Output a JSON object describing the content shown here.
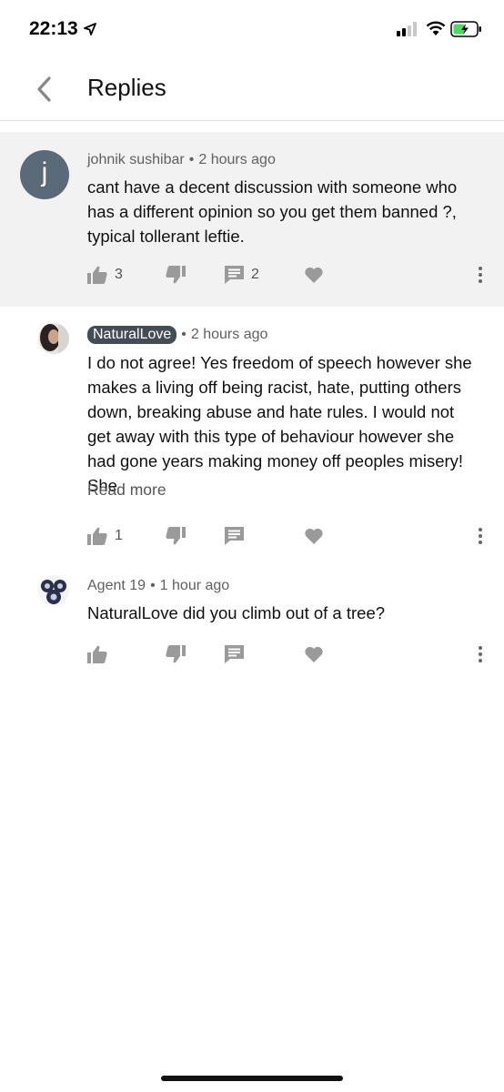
{
  "status_bar": {
    "time": "22:13"
  },
  "header": {
    "title": "Replies"
  },
  "comments": [
    {
      "author": "johnik sushibar",
      "avatar_letter": "j",
      "time": "2 hours ago",
      "text": "cant have a decent discussion with someone who has a different opinion so you get them banned ?, typical tollerant leftie.",
      "likes": "3",
      "replies": "2",
      "highlighted": true
    },
    {
      "author": "NaturalLove",
      "time": "2 hours ago",
      "text": "I do not agree! Yes freedom of speech however she makes a living off being racist, hate, putting others down, breaking abuse and hate rules. I would not get away with this type of behaviour however she had gone years making money off peoples misery! She",
      "read_more": "Read more",
      "likes": "1",
      "author_is_op": true
    },
    {
      "author": "Agent 19",
      "time": "1 hour ago",
      "text": "NaturalLove did you climb out of a tree?"
    }
  ],
  "icons": {
    "like": "thumbs-up-icon",
    "dislike": "thumbs-down-icon",
    "reply": "comment-icon",
    "heart": "heart-icon",
    "more": "more-vert-icon"
  },
  "colors": {
    "highlight_bg": "#f2f2f2",
    "chip_bg": "#444c56",
    "icon_gray": "#9a9a9a"
  }
}
